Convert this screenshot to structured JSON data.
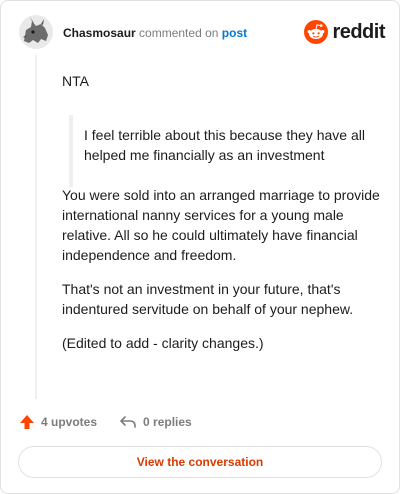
{
  "header": {
    "username": "Chasmosaur",
    "action": "commented on",
    "target": "post",
    "logo_text": "reddit"
  },
  "comment": {
    "intro": "NTA",
    "quote": "I feel terrible about this because they have all helped me financially as an investment",
    "paragraphs": [
      "You were sold into an arranged marriage to provide international nanny services for a young male relative. All so he could ultimately have financial independence and freedom.",
      "That's not an investment in your future, that's indentured servitude on behalf of your nephew.",
      "(Edited to add - clarity changes.)"
    ]
  },
  "footer": {
    "upvotes": "4 upvotes",
    "replies": "0 replies",
    "view_button": "View the conversation"
  },
  "colors": {
    "brand": "#ff4500",
    "link": "#0079d3",
    "button_text": "#d93a00",
    "muted": "#7c7c7c"
  },
  "icons": [
    "avatar",
    "reddit-logo-icon",
    "upvote-icon",
    "reply-icon"
  ]
}
